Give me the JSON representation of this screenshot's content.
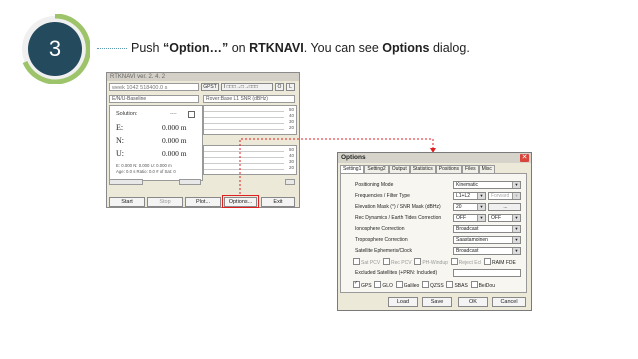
{
  "step": {
    "number": "3",
    "instruction_parts": [
      "Push ",
      "“Option…”",
      " on ",
      "RTKNAVI",
      ". You can see ",
      "Options",
      " dialog."
    ]
  },
  "rtknavi": {
    "title": "RTKNAVI ver. 2. 4. 2",
    "time": "week 1042 518400.0 s",
    "gpst_label": "GPST",
    "stream_indicator": "I  □□□→□→□□□",
    "btn_o": "O",
    "btn_l": "L",
    "left_select": "E/N/U-Baseline",
    "right_select": "Rover:Base L1 SNR (dBHz)",
    "solution_label": "Solution:",
    "solution_value": "----",
    "e_label": "E:",
    "e_value": "0.000 m",
    "n_label": "N:",
    "n_value": "0.000 m",
    "u_label": "U:",
    "u_value": "0.000 m",
    "sd_line": "E: 0.000 N: 0.000 U: 0.000 m",
    "age_line": "Age: 0.0 s Ratio: 0.0 # of Sat: 0",
    "plot_ticks_top": [
      "50",
      "40",
      "30",
      "20"
    ],
    "plot_ticks_bottom": [
      "50",
      "40",
      "30",
      "20"
    ],
    "buttons": {
      "start": "Start",
      "stop": "Stop",
      "plot": "Plot...",
      "options": "Options...",
      "exit": "Exit"
    }
  },
  "options": {
    "title": "Options",
    "tabs": [
      "Setting1",
      "Setting2",
      "Output",
      "Statistics",
      "Positions",
      "Files",
      "Misc"
    ],
    "fields": [
      {
        "label": "Positioning Mode",
        "value": "Kinematic"
      },
      {
        "label": "Frequencies / Filter Type",
        "value": "L1+L2",
        "value2": "Forward"
      },
      {
        "label": "Elevation Mask (°) / SNR Mask (dBHz)",
        "value": "20",
        "value2": "..."
      },
      {
        "label": "Rec Dynamics / Earth Tides Correction",
        "value": "OFF",
        "value2": "OFF"
      },
      {
        "label": "Ionosphere Correction",
        "value": "Broadcast"
      },
      {
        "label": "Troposphere Correction",
        "value": "Saastamoinen"
      },
      {
        "label": "Satellite Ephemeris/Clock",
        "value": "Broadcast"
      }
    ],
    "flags": [
      "Sat PCV",
      "Rec PCV",
      "PH-Windup",
      "Reject Ecl",
      "RAIM FDE"
    ],
    "excluded_label": "Excluded Satellites (+PRN: Included)",
    "constellations": [
      "GPS",
      "GLO",
      "Galileo",
      "QZSS",
      "SBAS",
      "BeiDou"
    ],
    "buttons": {
      "load": "Load",
      "save": "Save",
      "ok": "OK",
      "cancel": "Cancel"
    }
  },
  "colors": {
    "circle_fill": "#234a5d",
    "circle_ring": "#9dc46a",
    "highlight": "#e02020"
  }
}
